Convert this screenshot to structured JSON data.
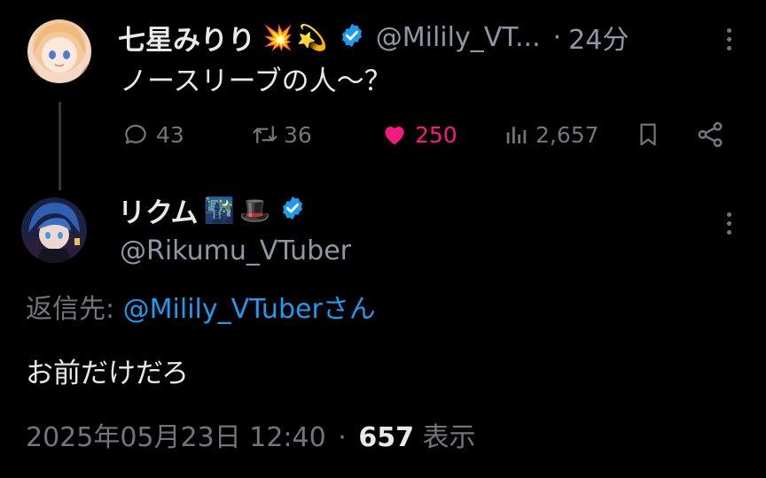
{
  "colors": {
    "background": "#000000",
    "text": "#e7e9ea",
    "muted": "#71767b",
    "accent": "#1d9bf0",
    "like": "#f91880",
    "verified": "#1d9bf0"
  },
  "parent_tweet": {
    "display_name": "七星みりり",
    "name_emojis": [
      "💥",
      "💫"
    ],
    "verified_icon": "verified-badge-icon",
    "handle": "@Milily_VT...",
    "separator": "·",
    "time_ago": "24分",
    "text": "ノースリーブの人～？",
    "actions": {
      "replies": "43",
      "retweets": "36",
      "likes": "250",
      "views": "2,657"
    },
    "icons": [
      "reply-icon",
      "retweet-icon",
      "heart-icon",
      "views-icon",
      "bookmark-icon",
      "share-icon",
      "more-icon"
    ]
  },
  "reply_tweet": {
    "display_name": "リクム",
    "name_emojis": [
      "🌃",
      "🎩"
    ],
    "verified_icon": "verified-badge-icon",
    "handle": "@Rikumu_VTuber",
    "reply_to_label": "返信先:",
    "reply_to_mention": "@Milily_VTuberさん",
    "text": "お前だけだろ",
    "timestamp": "2025年05月23日 12:40",
    "separator": "·",
    "view_count": "657",
    "view_label": "表示"
  }
}
